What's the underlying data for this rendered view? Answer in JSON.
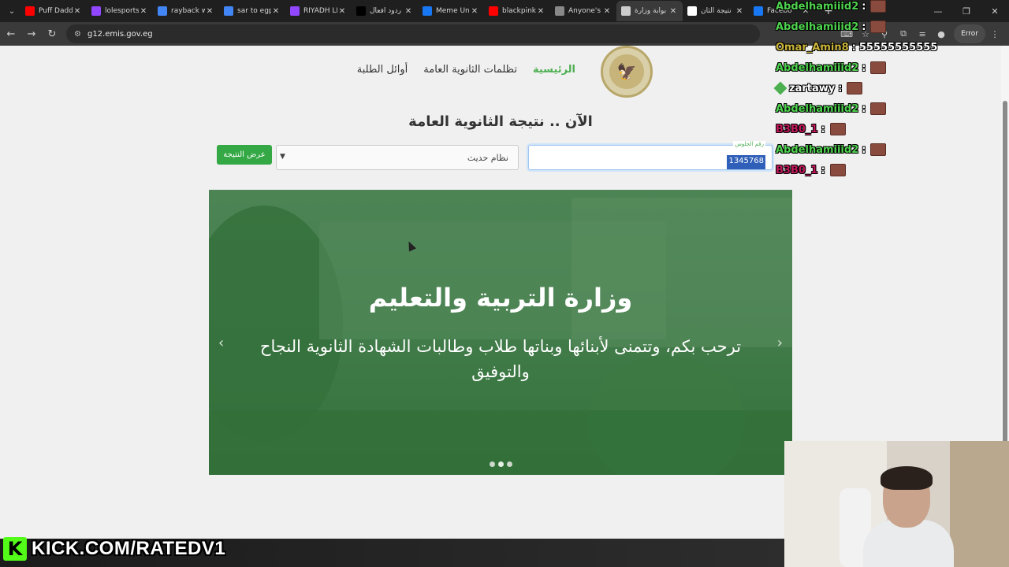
{
  "browser": {
    "tabs": [
      {
        "label": "Puff Daddy",
        "icon": "youtube-icon",
        "color": "#ff0000"
      },
      {
        "label": "lolesports",
        "icon": "twitch-icon",
        "color": "#9146ff"
      },
      {
        "label": "rayback w",
        "icon": "google-icon",
        "color": "#4285f4"
      },
      {
        "label": "sar to egp",
        "icon": "google-icon",
        "color": "#4285f4"
      },
      {
        "label": "RIYADH LI",
        "icon": "twitch-icon",
        "color": "#9146ff"
      },
      {
        "label": "ردود أفعال",
        "icon": "tiktok-icon",
        "color": "#000000"
      },
      {
        "label": "Meme Uni",
        "icon": "facebook-icon",
        "color": "#1877f2"
      },
      {
        "label": "blackpink",
        "icon": "youtube-icon",
        "color": "#ff0000"
      },
      {
        "label": "Anyone's L",
        "icon": "generic-icon",
        "color": "#888888"
      },
      {
        "label": "بوابة وزارة",
        "icon": "page-icon",
        "color": "#cccccc"
      },
      {
        "label": "نتيجة الثان",
        "icon": "page-icon",
        "color": "#ffffff"
      },
      {
        "label": "Facebo",
        "icon": "facebook-icon",
        "color": "#1877f2"
      }
    ],
    "active_tab_index": 9,
    "url": "g12.emis.gov.eg",
    "error_label": "Error"
  },
  "site": {
    "nav": [
      {
        "label": "الرئيسية",
        "active": true
      },
      {
        "label": "تظلمات الثانوية العامة",
        "active": false
      },
      {
        "label": "أوائل الطلبة",
        "active": false
      }
    ],
    "headline": "الآن .. نتيجة الثانوية العامة",
    "form": {
      "seat_label": "رقم الجلوس",
      "seat_value": "1345768",
      "system_value": "نظام حديث",
      "submit_label": "عرض النتيجة"
    },
    "hero": {
      "title": "وزارة التربية والتعليم",
      "subtitle": "ترحب بكم، وتتمنى لأبنائها وبناتها طلاب وطالبات الشهادة الثانوية النجاح والتوفيق",
      "slides": 3,
      "active_slide": 1
    }
  },
  "chat": [
    {
      "user": "Abdelhamiiid2",
      "msg": "",
      "color": "#4fd34f",
      "emote": true
    },
    {
      "user": "Abdelhamiiid2",
      "msg": "",
      "color": "#4fd34f",
      "emote": true
    },
    {
      "user": "Omar_Amin8",
      "msg": "55555555555",
      "color": "#c9b43a",
      "emote": false
    },
    {
      "user": "Abdelhamiiid2",
      "msg": "",
      "color": "#4fd34f",
      "emote": true
    },
    {
      "user": "zartawy",
      "msg": "",
      "color": "#ffffff",
      "emote": true,
      "badge": true
    },
    {
      "user": "Abdelhamiiid2",
      "msg": "",
      "color": "#4fd34f",
      "emote": true
    },
    {
      "user": "B3B0_1",
      "msg": "",
      "color": "#c2185b",
      "emote": true
    },
    {
      "user": "Abdelhamiiid2",
      "msg": "",
      "color": "#4fd34f",
      "emote": true
    },
    {
      "user": "B3B0_1",
      "msg": "",
      "color": "#c2185b",
      "emote": true
    }
  ],
  "stream": {
    "kick_logo": "K",
    "kick_text": "KICK.COM/RATEDV1"
  }
}
